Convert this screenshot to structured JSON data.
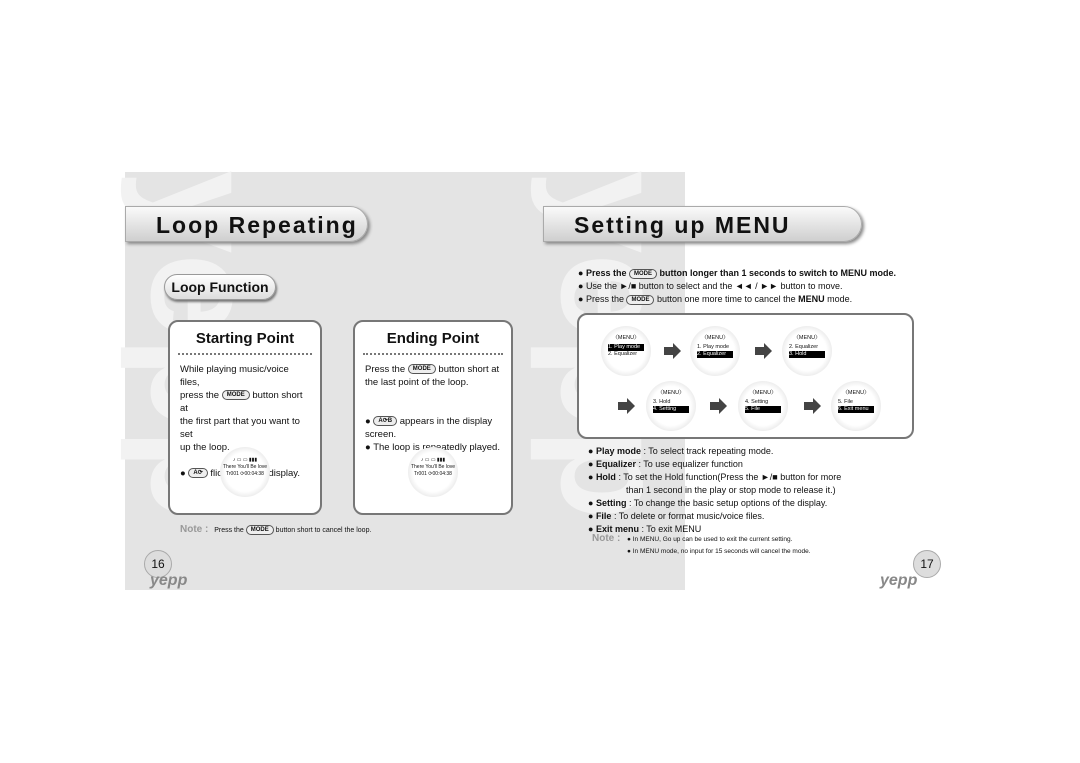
{
  "left": {
    "title": "Loop Repeating",
    "section": "Loop Function",
    "start": {
      "heading": "Starting Point",
      "lines": [
        "While playing music/voice files,",
        "press the",
        "button short at",
        "the first part that you want to set",
        "up the loop."
      ],
      "bullet": "flickers in the display."
    },
    "end": {
      "heading": "Ending Point",
      "lines": [
        "Press the",
        "button short at",
        "the last point of the loop."
      ],
      "bullets": [
        "appears in the display screen.",
        "The loop is repeatedly played."
      ]
    },
    "display": {
      "title": "There You'll Be love",
      "track": "Tr001",
      "time": "00:04:38"
    },
    "note_label": "Note :",
    "note_pre": "Press the",
    "note_post": "button short to cancel the loop.",
    "page": "16",
    "logo": "yepp"
  },
  "mode_label": "MODE",
  "right": {
    "title": "Setting up MENU",
    "b1_pre": "Press the",
    "b1_post": "button longer than 1 seconds to switch to MENU mode.",
    "b2": "Use the  ►/■  button to select and the  ◄◄ / ►► button to move.",
    "b3_pre": "Press the",
    "b3_mid": "button one more time to cancel the",
    "b3_bold": "MENU",
    "b3_post": "mode.",
    "screens": [
      {
        "title": "〈MENU〉",
        "l1": "1. Play mode",
        "l2": "2. Equalizer",
        "hl": 1
      },
      {
        "title": "〈MENU〉",
        "l1": "1. Play mode",
        "l2": "2. Equalizer",
        "hl": 2
      },
      {
        "title": "〈MENU〉",
        "l1": "2. Equalizer",
        "l2": "3. Hold",
        "hl": 2
      },
      {
        "title": "〈MENU〉",
        "l1": "3. Hold",
        "l2": "4. Setting",
        "hl": 2
      },
      {
        "title": "〈MENU〉",
        "l1": "4. Setting",
        "l2": "5. File",
        "hl": 2
      },
      {
        "title": "〈MENU〉",
        "l1": "5. File",
        "l2": "6. Exit menu",
        "hl": 2
      }
    ],
    "desc": [
      {
        "k": "Play mode",
        "v": " : To select track repeating mode."
      },
      {
        "k": "Equalizer",
        "v": " : To use equalizer function"
      },
      {
        "k": "Hold",
        "v": " : To set the Hold function(Press the  ►/■ button for more"
      },
      {
        "k": "Setting",
        "v": " : To change the basic setup options of the display."
      },
      {
        "k": "File",
        "v": " : To delete or format music/voice files."
      },
      {
        "k": "Exit menu",
        "v": " : To exit MENU"
      }
    ],
    "hold_cont": "than 1 second in the play or stop mode to release it.)",
    "note_label": "Note :",
    "notes": [
      "In MENU, Go up can be used to exit the current setting.",
      "In MENU mode, no input for 15 seconds will cancel the mode."
    ],
    "page": "17",
    "logo": "yepp"
  }
}
